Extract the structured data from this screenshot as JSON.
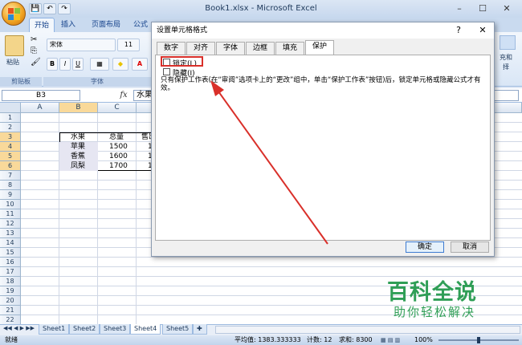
{
  "window": {
    "title": "Book1.xlsx - Microsoft Excel",
    "minimize": "–",
    "maximize": "☐",
    "close": "✕"
  },
  "ribbon": {
    "tabs": [
      "开始",
      "插入",
      "页面布局",
      "公式"
    ],
    "font_name": "宋体",
    "font_size": "11",
    "paste_label": "粘贴",
    "clipboard_label": "剪贴板",
    "font_group_label": "字体",
    "bold": "B",
    "italic": "I",
    "underline": "U",
    "right_fragment_1": "充和",
    "right_fragment_2": "择"
  },
  "formula": {
    "namebox": "B3",
    "fx": "fx",
    "value": "水果"
  },
  "sheet": {
    "columns": [
      "A",
      "B",
      "C"
    ],
    "rows": [
      "1",
      "2",
      "3",
      "4",
      "5",
      "6",
      "7",
      "8",
      "9",
      "10",
      "11",
      "12",
      "13",
      "14",
      "15",
      "16",
      "17",
      "18",
      "19",
      "20",
      "21",
      "22"
    ],
    "table": {
      "header": [
        "水果",
        "总量",
        "售出"
      ],
      "rows": [
        [
          "苹果",
          "1500",
          "1"
        ],
        [
          "香蕉",
          "1600",
          "1"
        ],
        [
          "凤梨",
          "1700",
          "1"
        ]
      ]
    },
    "tabs": [
      "Sheet1",
      "Sheet2",
      "Sheet3",
      "Sheet4",
      "Sheet5"
    ],
    "active_tab": "Sheet4"
  },
  "status": {
    "mode": "就绪",
    "average": "平均值: 1383.333333",
    "count": "计数: 12",
    "sum": "求和: 8300",
    "zoom": "100%"
  },
  "dialog": {
    "title": "设置单元格格式",
    "help": "?",
    "close": "✕",
    "tabs": [
      "数字",
      "对齐",
      "字体",
      "边框",
      "填充",
      "保护"
    ],
    "active_tab": "保护",
    "locked_label": "锁定(L)",
    "locked_checked": false,
    "hidden_label": "隐藏(I)",
    "hidden_checked": false,
    "note": "只有保护工作表(在“审阅”选项卡上的“更改”组中，单击“保护工作表”按钮)后，锁定单元格或隐藏公式才有效。",
    "ok": "确定",
    "cancel": "取消"
  },
  "watermark": {
    "line1": "百科全说",
    "line2": "助你轻松解决"
  },
  "colors": {
    "annotation": "#d9302a",
    "watermark": "#2f9e56",
    "ribbon": "#dfe8f5"
  }
}
